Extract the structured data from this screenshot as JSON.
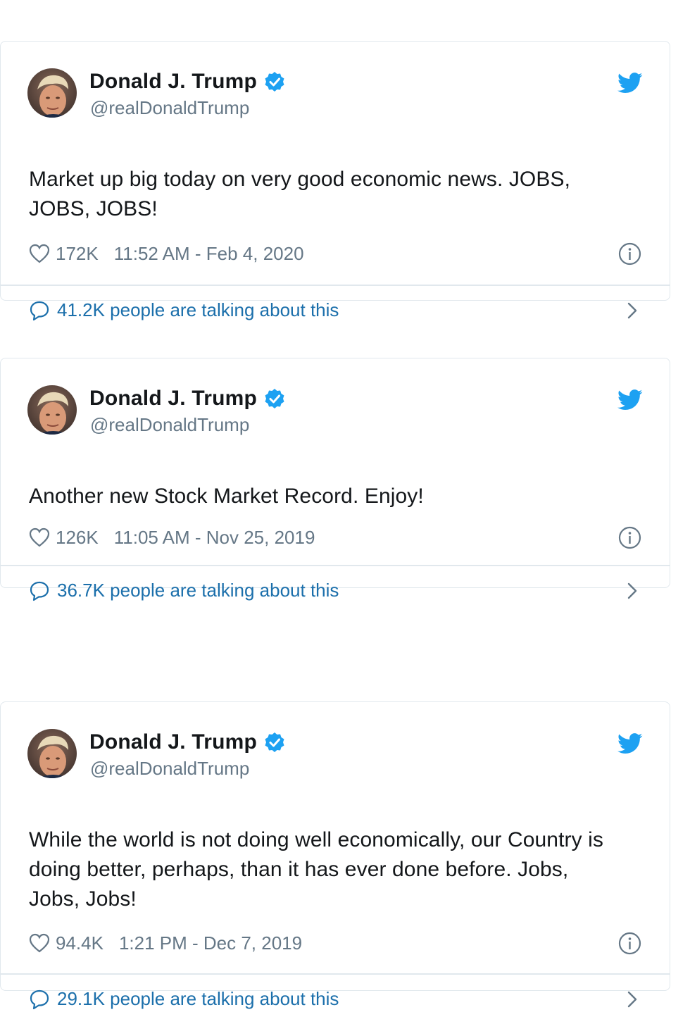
{
  "colors": {
    "verified": "#1da1f2",
    "link": "#1b6fab",
    "muted": "#657786",
    "border": "#e1e8ed"
  },
  "icons": [
    "avatar",
    "verified-badge-icon",
    "twitter-bird-icon",
    "heart-icon",
    "info-icon",
    "comment-icon",
    "chevron-right-icon"
  ],
  "tweets": [
    {
      "name": "Donald J. Trump",
      "handle": "@realDonaldTrump",
      "text": "Market up big today on very good economic news. JOBS, JOBS, JOBS!",
      "likes": "172K",
      "time": "11:52 AM - Feb 4, 2020",
      "talking": "41.2K people are talking about this"
    },
    {
      "name": "Donald J. Trump",
      "handle": "@realDonaldTrump",
      "text": "Another new Stock Market Record. Enjoy!",
      "likes": "126K",
      "time": "11:05 AM - Nov 25, 2019",
      "talking": "36.7K people are talking about this"
    },
    {
      "name": "Donald J. Trump",
      "handle": "@realDonaldTrump",
      "text": "While the world is not doing well economically, our Country is doing better, perhaps, than it has ever done before. Jobs, Jobs, Jobs!",
      "likes": "94.4K",
      "time": "1:21 PM - Dec 7, 2019",
      "talking": "29.1K people are talking about this"
    }
  ]
}
